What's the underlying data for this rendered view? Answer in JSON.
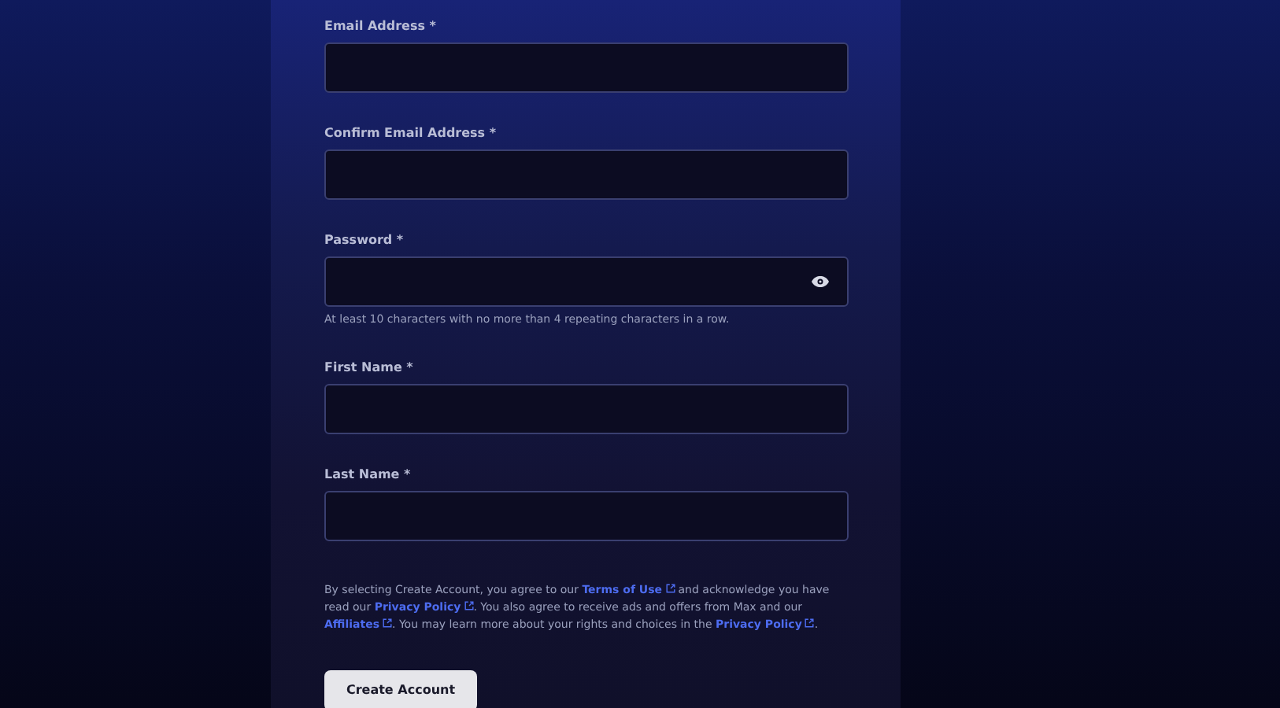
{
  "fields": [
    {
      "label": "Email Address *",
      "kind": "text"
    },
    {
      "label": "Confirm Email Address *",
      "kind": "text"
    },
    {
      "label": "Password *",
      "kind": "password",
      "hint": "At least 10 characters with no more than 4 repeating characters in a row."
    },
    {
      "label": "First Name *",
      "kind": "text"
    },
    {
      "label": "Last Name *",
      "kind": "text"
    }
  ],
  "consent": [
    {
      "kind": "text",
      "text": "By selecting Create Account, you agree to our "
    },
    {
      "kind": "link",
      "text": "Terms of Use"
    },
    {
      "kind": "text",
      "text": " and acknowledge you have read our "
    },
    {
      "kind": "link",
      "text": "Privacy Policy"
    },
    {
      "kind": "text",
      "text": ". You also agree to receive ads and offers from Max and our "
    },
    {
      "kind": "link",
      "text": "Affiliates"
    },
    {
      "kind": "text",
      "text": ". You may learn more about your rights and choices in the "
    },
    {
      "kind": "link",
      "text": "Privacy Policy"
    },
    {
      "kind": "text",
      "text": "."
    }
  ],
  "submit": {
    "label": "Create Account"
  }
}
